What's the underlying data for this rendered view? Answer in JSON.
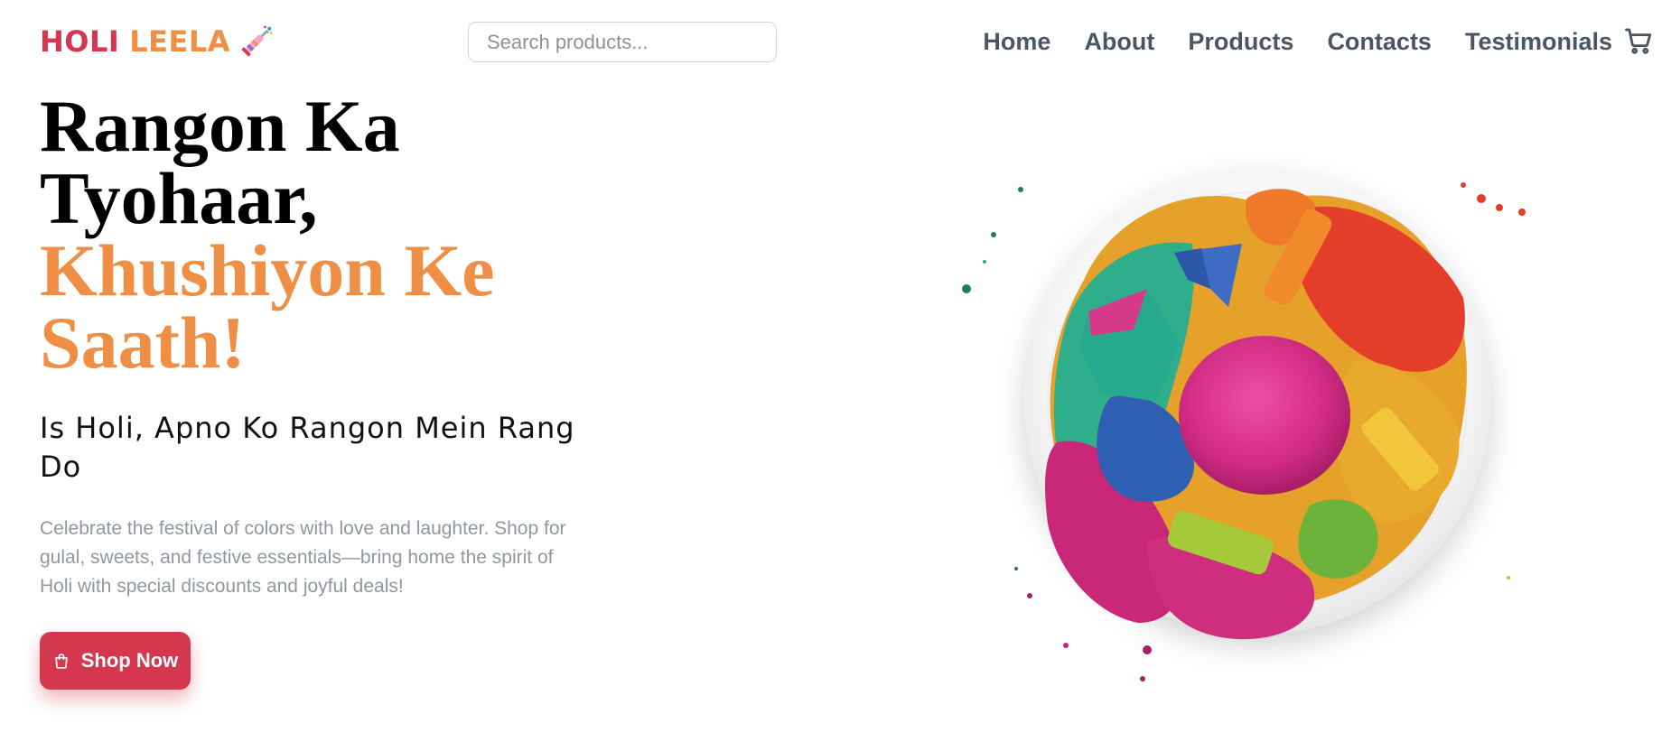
{
  "brand": {
    "word1": "HOLI",
    "word2": "LEELA",
    "icon": "pichkari-icon",
    "colors": {
      "primary": "#d5374f",
      "accent": "#ef8f45"
    }
  },
  "search": {
    "placeholder": "Search products...",
    "value": ""
  },
  "nav": {
    "items": [
      {
        "label": "Home"
      },
      {
        "label": "About"
      },
      {
        "label": "Products"
      },
      {
        "label": "Contacts"
      },
      {
        "label": "Testimonials"
      }
    ],
    "cart_icon": "cart-icon"
  },
  "hero": {
    "title_line1": "Rangon Ka",
    "title_line2": "Tyohaar,",
    "title_accent_line1": "Khushiyon Ke",
    "title_accent_line2": "Saath!",
    "subtitle": "Is Holi, Apno Ko Rangon Mein Rang Do",
    "description": "Celebrate the festival of colors with love and laughter. Shop for gulal, sweets, and festive essentials—bring home the spirit of Holi with special discounts and joyful deals!",
    "cta": {
      "label": "Shop Now",
      "icon": "shopping-bag-icon"
    },
    "image": "holi-color-powder-plate"
  }
}
